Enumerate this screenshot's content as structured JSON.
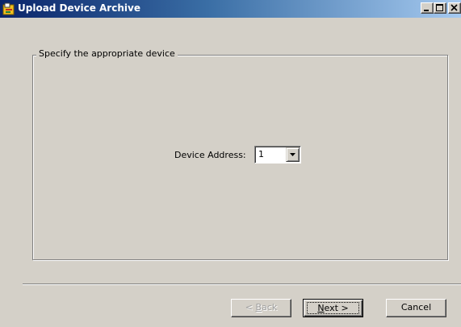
{
  "window": {
    "title": "Upload Device Archive",
    "app_icon": "wizard-app-icon",
    "controls": [
      "minimize-icon",
      "maximize-icon",
      "close-icon"
    ]
  },
  "group": {
    "legend": "Specify the appropriate device",
    "device_address_label": "Device Address:",
    "device_address_value": "1"
  },
  "buttons": {
    "back_mnemonic": "B",
    "back_rest": "ack",
    "back_prefix": "< ",
    "next_mnemonic": "N",
    "next_rest": "ext >",
    "cancel": "Cancel"
  },
  "colors": {
    "face": "#d4d0c8",
    "title_start": "#0a246a",
    "title_end": "#a6caf0",
    "disabled_text": "#a0a0a0"
  }
}
